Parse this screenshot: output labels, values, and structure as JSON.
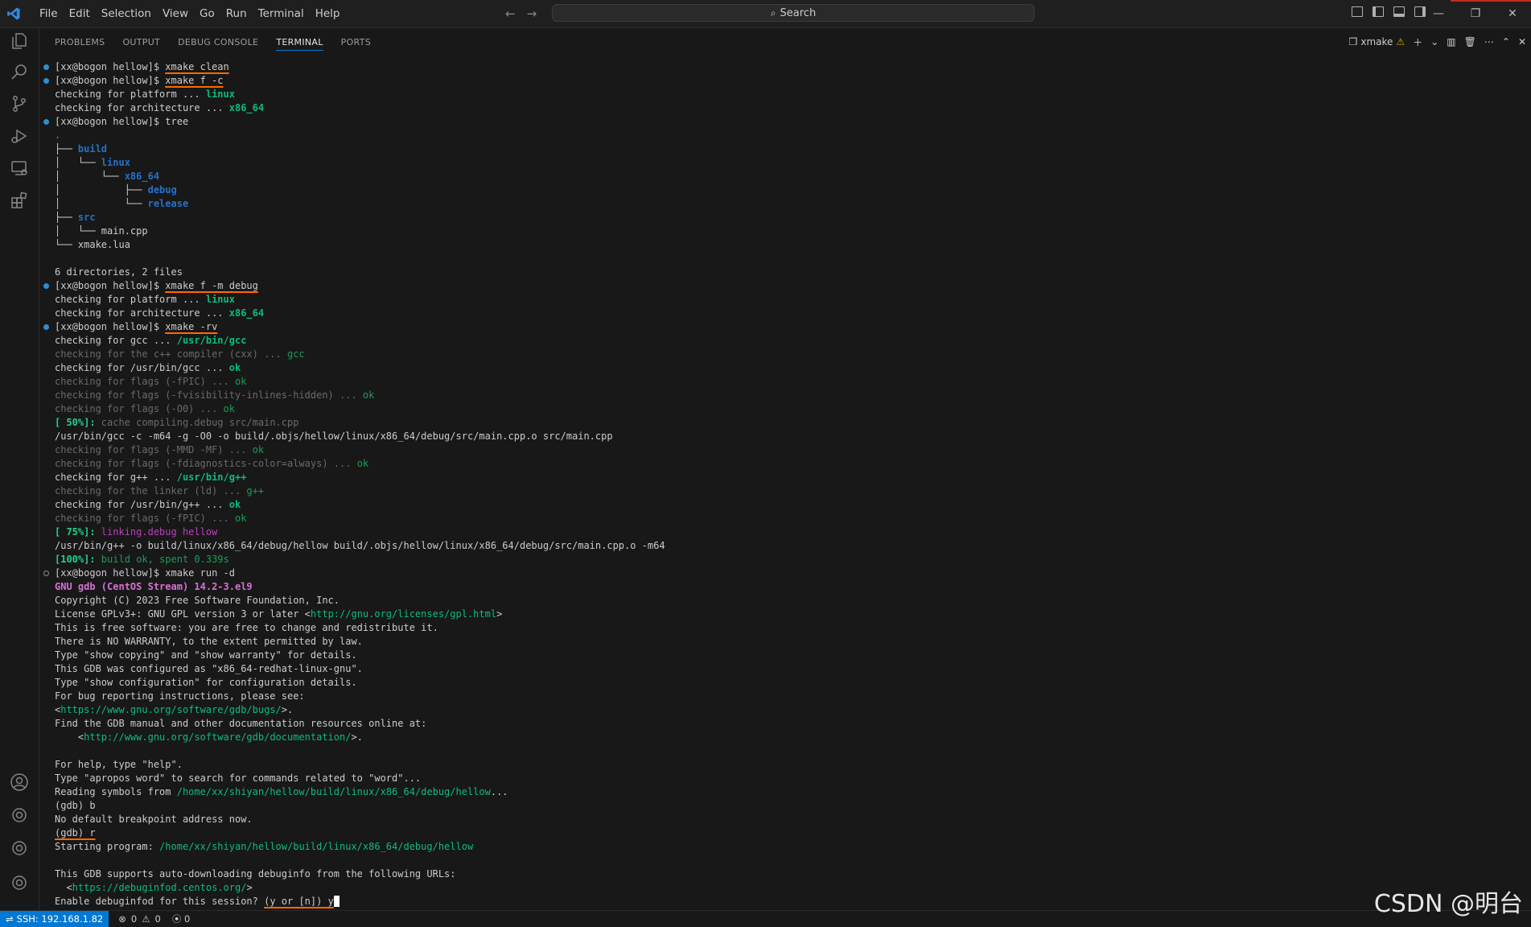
{
  "menu": [
    "File",
    "Edit",
    "Selection",
    "View",
    "Go",
    "Run",
    "Terminal",
    "Help"
  ],
  "search": {
    "label": "Search"
  },
  "panel": {
    "tabs": [
      "PROBLEMS",
      "OUTPUT",
      "DEBUG CONSOLE",
      "TERMINAL",
      "PORTS"
    ],
    "active_tab": "TERMINAL",
    "terminal_name": "xmake"
  },
  "terminal_lines": [
    {
      "d": "blue",
      "s": [
        [
          "[xx@bogon hellow]$ ",
          ""
        ],
        [
          "xmake clean",
          "ul"
        ]
      ]
    },
    {
      "d": "blue",
      "s": [
        [
          "[xx@bogon hellow]$ ",
          ""
        ],
        [
          "xmake f -c",
          "ul"
        ]
      ]
    },
    {
      "s": [
        [
          "checking for platform ... ",
          ""
        ],
        [
          "linux",
          "g"
        ]
      ]
    },
    {
      "s": [
        [
          "checking for architecture ... ",
          ""
        ],
        [
          "x86_64",
          "g"
        ]
      ]
    },
    {
      "d": "blue",
      "s": [
        [
          "[xx@bogon hellow]$ tree",
          ""
        ]
      ]
    },
    {
      "s": [
        [
          ".",
          "bb"
        ]
      ]
    },
    {
      "s": [
        [
          "├── ",
          ""
        ],
        [
          "build",
          "bb"
        ]
      ]
    },
    {
      "s": [
        [
          "│   └── ",
          ""
        ],
        [
          "linux",
          "bb"
        ]
      ]
    },
    {
      "s": [
        [
          "│       └── ",
          ""
        ],
        [
          "x86_64",
          "bb"
        ]
      ]
    },
    {
      "s": [
        [
          "│           ├── ",
          ""
        ],
        [
          "debug",
          "bb"
        ]
      ]
    },
    {
      "s": [
        [
          "│           └── ",
          ""
        ],
        [
          "release",
          "bb"
        ]
      ]
    },
    {
      "s": [
        [
          "├── ",
          ""
        ],
        [
          "src",
          "bb"
        ]
      ]
    },
    {
      "s": [
        [
          "│   └── main.cpp",
          ""
        ]
      ]
    },
    {
      "s": [
        [
          "└── xmake.lua",
          ""
        ]
      ]
    },
    {
      "s": [
        [
          "",
          ""
        ]
      ]
    },
    {
      "s": [
        [
          "6 directories, 2 files",
          ""
        ]
      ]
    },
    {
      "d": "blue",
      "s": [
        [
          "[xx@bogon hellow]$ ",
          ""
        ],
        [
          "xmake f -m debug",
          "ul"
        ]
      ]
    },
    {
      "s": [
        [
          "checking for platform ... ",
          ""
        ],
        [
          "linux",
          "g"
        ]
      ]
    },
    {
      "s": [
        [
          "checking for architecture ... ",
          ""
        ],
        [
          "x86_64",
          "g"
        ]
      ]
    },
    {
      "d": "blue",
      "s": [
        [
          "[xx@bogon hellow]$ ",
          ""
        ],
        [
          "xmake -rv",
          "ul"
        ]
      ]
    },
    {
      "s": [
        [
          "checking for gcc ... ",
          ""
        ],
        [
          "/usr/bin/gcc",
          "g"
        ]
      ]
    },
    {
      "s": [
        [
          "checking for the c++ compiler (cxx) ... ",
          "dim"
        ],
        [
          "gcc",
          "dg"
        ]
      ]
    },
    {
      "s": [
        [
          "checking for /usr/bin/gcc ... ",
          ""
        ],
        [
          "ok",
          "g"
        ]
      ]
    },
    {
      "s": [
        [
          "checking for flags (-fPIC) ... ",
          "dim"
        ],
        [
          "ok",
          "dg"
        ]
      ]
    },
    {
      "s": [
        [
          "checking for flags (-fvisibility-inlines-hidden) ... ",
          "dim"
        ],
        [
          "ok",
          "dg"
        ]
      ]
    },
    {
      "s": [
        [
          "checking for flags (-O0) ... ",
          "dim"
        ],
        [
          "ok",
          "dg"
        ]
      ]
    },
    {
      "s": [
        [
          "[ 50%]:",
          "pct"
        ],
        [
          " cache compiling.debug src/main.cpp",
          "dim"
        ]
      ]
    },
    {
      "s": [
        [
          "/usr/bin/gcc -c -m64 -g -O0 -o build/.objs/hellow/linux/x86_64/debug/src/main.cpp.o src/main.cpp",
          ""
        ]
      ]
    },
    {
      "s": [
        [
          "checking for flags (-MMD -MF) ... ",
          "dim"
        ],
        [
          "ok",
          "dg"
        ]
      ]
    },
    {
      "s": [
        [
          "checking for flags (-fdiagnostics-color=always) ... ",
          "dim"
        ],
        [
          "ok",
          "dg"
        ]
      ]
    },
    {
      "s": [
        [
          "checking for g++ ... ",
          ""
        ],
        [
          "/usr/bin/g++",
          "g"
        ]
      ]
    },
    {
      "s": [
        [
          "checking for the linker (ld) ... ",
          "dim"
        ],
        [
          "g++",
          "dg"
        ]
      ]
    },
    {
      "s": [
        [
          "checking for /usr/bin/g++ ... ",
          ""
        ],
        [
          "ok",
          "g"
        ]
      ]
    },
    {
      "s": [
        [
          "checking for flags (-fPIC) ... ",
          "dim"
        ],
        [
          "ok",
          "dg"
        ]
      ]
    },
    {
      "s": [
        [
          "[ 75%]:",
          "pct"
        ],
        [
          " linking.debug hellow",
          "m"
        ]
      ]
    },
    {
      "s": [
        [
          "/usr/bin/g++ -o build/linux/x86_64/debug/hellow build/.objs/hellow/linux/x86_64/debug/src/main.cpp.o -m64",
          ""
        ]
      ]
    },
    {
      "s": [
        [
          "[100%]:",
          "pct"
        ],
        [
          " build ok, spent 0.339s",
          "dg"
        ]
      ]
    },
    {
      "d": "hollow",
      "s": [
        [
          "[xx@bogon hellow]$ xmake run -d",
          ""
        ]
      ]
    },
    {
      "s": [
        [
          "GNU gdb (CentOS Stream) 14.2-3.el9",
          "mb"
        ]
      ]
    },
    {
      "s": [
        [
          "Copyright (C) 2023 Free Software Foundation, Inc.",
          ""
        ]
      ]
    },
    {
      "s": [
        [
          "License GPLv3+: GNU GPL version 3 or later <",
          ""
        ],
        [
          "http://gnu.org/licenses/gpl.html",
          "url"
        ],
        [
          ">",
          ""
        ]
      ]
    },
    {
      "s": [
        [
          "This is free software: you are free to change and redistribute it.",
          ""
        ]
      ]
    },
    {
      "s": [
        [
          "There is NO WARRANTY, to the extent permitted by law.",
          ""
        ]
      ]
    },
    {
      "s": [
        [
          "Type \"show copying\" and \"show warranty\" for details.",
          ""
        ]
      ]
    },
    {
      "s": [
        [
          "This GDB was configured as \"x86_64-redhat-linux-gnu\".",
          ""
        ]
      ]
    },
    {
      "s": [
        [
          "Type \"show configuration\" for configuration details.",
          ""
        ]
      ]
    },
    {
      "s": [
        [
          "For bug reporting instructions, please see:",
          ""
        ]
      ]
    },
    {
      "s": [
        [
          "<",
          ""
        ],
        [
          "https://www.gnu.org/software/gdb/bugs/",
          "url"
        ],
        [
          ">.",
          ""
        ]
      ]
    },
    {
      "s": [
        [
          "Find the GDB manual and other documentation resources online at:",
          ""
        ]
      ]
    },
    {
      "s": [
        [
          "    <",
          ""
        ],
        [
          "http://www.gnu.org/software/gdb/documentation/",
          "url"
        ],
        [
          ">.",
          ""
        ]
      ]
    },
    {
      "s": [
        [
          "",
          ""
        ]
      ]
    },
    {
      "s": [
        [
          "For help, type \"help\".",
          ""
        ]
      ]
    },
    {
      "s": [
        [
          "Type \"apropos word\" to search for commands related to \"word\"...",
          ""
        ]
      ]
    },
    {
      "s": [
        [
          "Reading symbols from ",
          ""
        ],
        [
          "/home/xx/shiyan/hellow/build/linux/x86_64/debug/hellow",
          "url"
        ],
        [
          "...",
          ""
        ]
      ]
    },
    {
      "s": [
        [
          "(gdb) b",
          ""
        ]
      ]
    },
    {
      "s": [
        [
          "No default breakpoint address now.",
          ""
        ]
      ]
    },
    {
      "s": [
        [
          "(gdb) r",
          "ul"
        ]
      ]
    },
    {
      "s": [
        [
          "Starting program: ",
          ""
        ],
        [
          "/home/xx/shiyan/hellow/build/linux/x86_64/debug/hellow",
          "url"
        ]
      ]
    },
    {
      "s": [
        [
          "",
          ""
        ]
      ]
    },
    {
      "s": [
        [
          "This GDB supports auto-downloading debuginfo from the following URLs:",
          ""
        ]
      ]
    },
    {
      "s": [
        [
          "  <",
          ""
        ],
        [
          "https://debuginfod.centos.org/",
          "url"
        ],
        [
          ">",
          ""
        ]
      ]
    },
    {
      "s": [
        [
          "Enable debuginfod for this session? ",
          ""
        ],
        [
          "(y or [n]) y",
          "ul"
        ],
        [
          " ",
          "cursor"
        ]
      ]
    }
  ],
  "status": {
    "remote": "SSH: 192.168.1.82",
    "errors": "0",
    "warnings": "0",
    "ports": "0"
  },
  "watermark": "CSDN @明台"
}
